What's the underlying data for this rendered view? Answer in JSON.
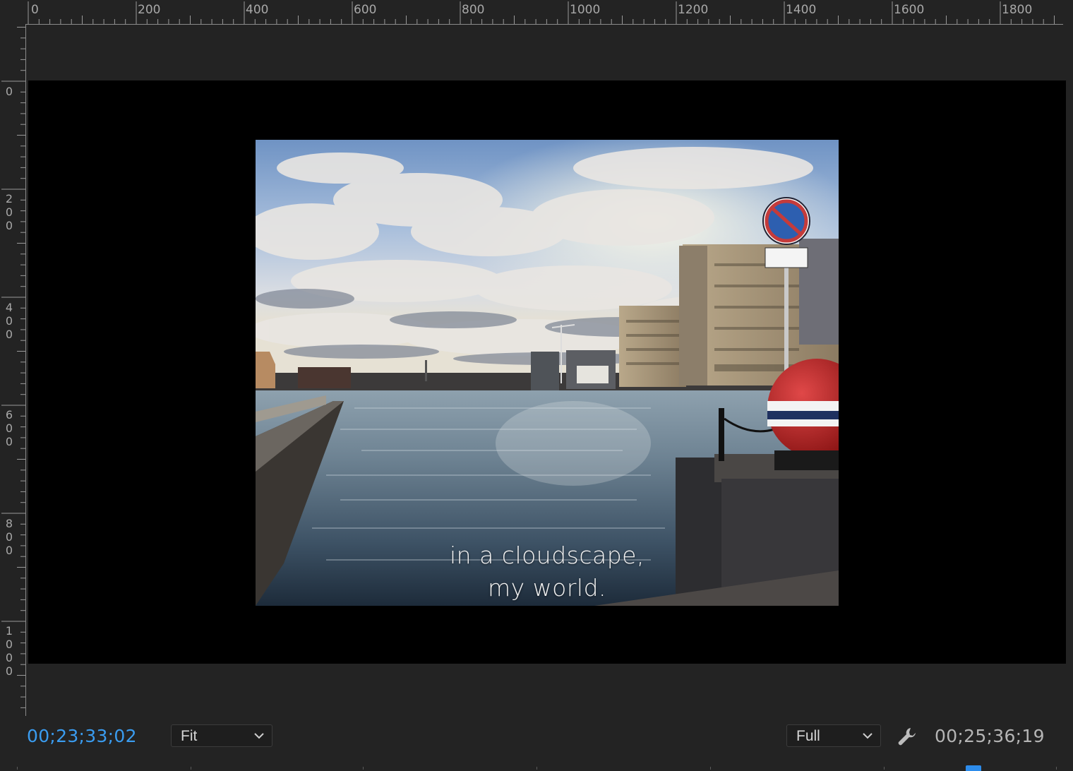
{
  "ruler": {
    "horizontal_labels": [
      "0",
      "200",
      "400",
      "600",
      "800",
      "1000",
      "1200",
      "1400",
      "1600",
      "1800"
    ],
    "vertical_labels": [
      "0",
      "200",
      "400",
      "600",
      "800",
      "1000"
    ]
  },
  "monitor": {
    "caption_line1": "in a cloudscape,",
    "caption_line2": "my world."
  },
  "controls": {
    "current_timecode": "00;23;33;02",
    "duration_timecode": "00;25;36;19",
    "zoom_dropdown": {
      "selected": "Fit"
    },
    "quality_dropdown": {
      "selected": "Full"
    },
    "settings_icon": "wrench-icon"
  },
  "colors": {
    "panel_bg": "#232323",
    "canvas_bg": "#000000",
    "timecode_accent": "#3a9cf0",
    "playhead": "#2d8ceb"
  }
}
